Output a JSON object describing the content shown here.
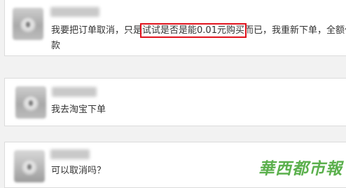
{
  "messages": [
    {
      "text_before": "我要把订单取消，只是",
      "text_highlight": "试试是否是能0.01元购买",
      "text_after": "而已，我重新下单，全额付",
      "text_line2": "款"
    },
    {
      "text": "我去淘宝下单"
    },
    {
      "text": "可以取消吗？"
    }
  ],
  "watermark": {
    "text": "華西都市報",
    "color": "#4aa83a"
  },
  "colors": {
    "highlight_box": "#e0141e",
    "card_background": "#ffffff",
    "page_background": "#f2f2f2"
  }
}
